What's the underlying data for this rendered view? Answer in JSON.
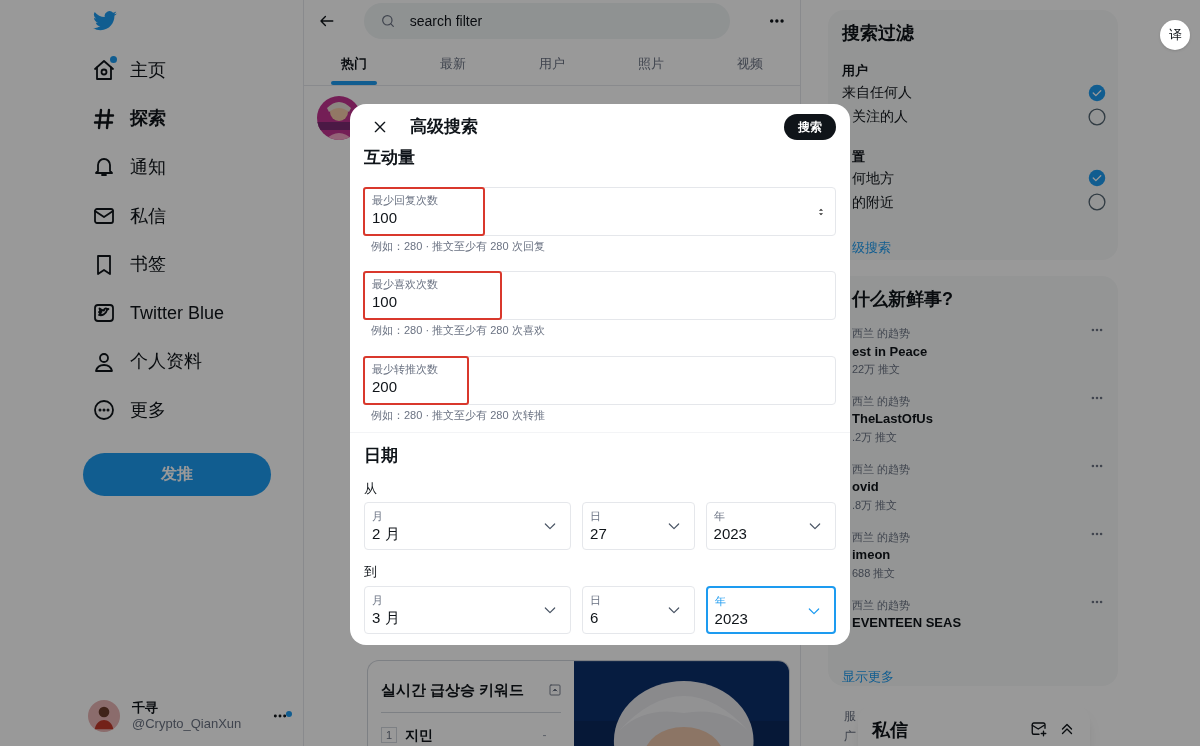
{
  "sidebar": {
    "items": [
      {
        "label": "主页",
        "selected": false,
        "badge": true
      },
      {
        "label": "探索",
        "selected": true,
        "badge": false
      },
      {
        "label": "通知",
        "selected": false,
        "badge": false
      },
      {
        "label": "私信",
        "selected": false,
        "badge": false
      },
      {
        "label": "书签",
        "selected": false,
        "badge": false
      },
      {
        "label": "Twitter Blue",
        "selected": false,
        "badge": false
      },
      {
        "label": "个人资料",
        "selected": false,
        "badge": false
      },
      {
        "label": "更多",
        "selected": false,
        "badge": false
      }
    ],
    "post_button": "发推",
    "account": {
      "name": "千寻",
      "handle": "@Crypto_QianXun",
      "badge": true
    }
  },
  "search_header": {
    "query": "search filter"
  },
  "tabs": [
    {
      "label": "热门",
      "selected": true
    },
    {
      "label": "最新",
      "selected": false
    },
    {
      "label": "用户",
      "selected": false
    },
    {
      "label": "照片",
      "selected": false
    },
    {
      "label": "视频",
      "selected": false
    }
  ],
  "feed": {
    "card_title": "실시간 급상승 키워드",
    "keywords": [
      {
        "rank": "1",
        "keyword": "지민",
        "change": "-"
      }
    ]
  },
  "filter_panel": {
    "title": "搜索过滤",
    "groups": [
      {
        "heading": "用户",
        "options": [
          {
            "label": "来自任何人",
            "selected": true
          },
          {
            "label": "关注的人",
            "selected": false
          }
        ]
      },
      {
        "heading": "置",
        "options": [
          {
            "label": "何地方",
            "selected": true
          },
          {
            "label": "的附近",
            "selected": false
          }
        ]
      }
    ],
    "link": "级搜索"
  },
  "trends": {
    "title": "什么新鲜事?",
    "items": [
      {
        "context": "西兰 的趋势",
        "name": "est in Peace",
        "count": "22万 推文"
      },
      {
        "context": "西兰 的趋势",
        "name": "TheLastOfUs",
        "count": ".2万 推文"
      },
      {
        "context": "西兰 的趋势",
        "name": "ovid",
        "count": ".8万 推文"
      },
      {
        "context": "西兰 的趋势",
        "name": "imeon",
        "count": "688 推文"
      },
      {
        "context": "西兰 的趋势",
        "name": "EVENTEEN SEAS"
      }
    ],
    "show_more": "显示更多"
  },
  "footer": [
    "服",
    "广"
  ],
  "dm_panel": {
    "title": "私信"
  },
  "translate_button": "译",
  "modal": {
    "title": "高级搜索",
    "search_button": "搜索",
    "engagement": {
      "heading": "互动量",
      "fields": [
        {
          "label": "最少回复次数",
          "value": "100",
          "hint": "例如：280 · 推文至少有 280 次回复",
          "stepper": true,
          "highlighted": true
        },
        {
          "label": "最少喜欢次数",
          "value": "100",
          "hint": "例如：280 · 推文至少有 280 次喜欢",
          "stepper": false,
          "highlighted": true
        },
        {
          "label": "最少转推次数",
          "value": "200",
          "hint": "例如：280 · 推文至少有 280 次转推",
          "stepper": false,
          "highlighted": true
        }
      ]
    },
    "dates": {
      "heading": "日期",
      "ranges": [
        {
          "label": "从",
          "selects": [
            {
              "label": "月",
              "value": "2 月",
              "focused": false
            },
            {
              "label": "日",
              "value": "27",
              "focused": false
            },
            {
              "label": "年",
              "value": "2023",
              "focused": false
            }
          ]
        },
        {
          "label": "到",
          "selects": [
            {
              "label": "月",
              "value": "3 月",
              "focused": false
            },
            {
              "label": "日",
              "value": "6",
              "focused": false
            },
            {
              "label": "年",
              "value": "2023",
              "focused": true
            }
          ]
        }
      ]
    }
  }
}
